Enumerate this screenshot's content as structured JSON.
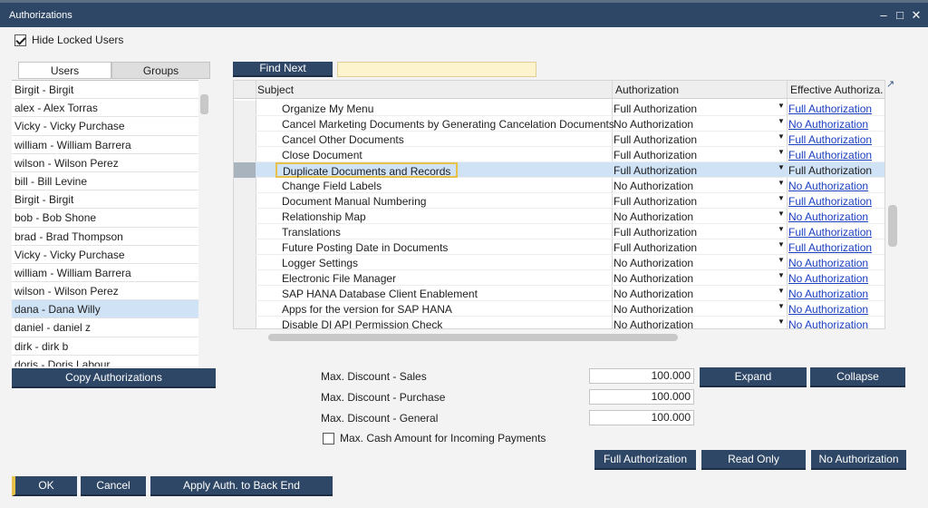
{
  "window": {
    "title": "Authorizations"
  },
  "hide_locked": {
    "label": "Hide Locked Users",
    "checked": true
  },
  "tabs": [
    {
      "label": "Users"
    },
    {
      "label": "Groups"
    }
  ],
  "users": [
    "Birgit - Birgit",
    "alex - Alex Torras",
    "Vicky - Vicky Purchase",
    "william - William Barrera",
    "wilson - Wilson Perez",
    "bill - Bill Levine",
    "Birgit - Birgit",
    "bob - Bob Shone",
    "brad - Brad Thompson",
    "Vicky - Vicky Purchase",
    "william - William Barrera",
    "wilson - Wilson Perez",
    "dana - Dana Willy",
    "daniel - daniel z",
    "dirk - dirk b",
    "doris - Doris Labour"
  ],
  "selected_user": "dana - Dana Willy",
  "find_next": {
    "label": "Find Next",
    "value": ""
  },
  "grid": {
    "headers": {
      "subject": "Subject",
      "authorization": "Authorization",
      "effective": "Effective Authoriza..."
    },
    "rows": [
      {
        "subject": "Organize My Menu",
        "authorization": "Full Authorization",
        "effective": "Full Authorization"
      },
      {
        "subject": "Cancel Marketing Documents by Generating Cancelation Documents",
        "authorization": "No Authorization",
        "effective": "No Authorization"
      },
      {
        "subject": "Cancel Other Documents",
        "authorization": "Full Authorization",
        "effective": "Full Authorization"
      },
      {
        "subject": "Close Document",
        "authorization": "Full Authorization",
        "effective": "Full Authorization"
      },
      {
        "subject": "Duplicate Documents and Records",
        "authorization": "Full Authorization",
        "effective": "Full Authorization"
      },
      {
        "subject": "Change Field Labels",
        "authorization": "No Authorization",
        "effective": "No Authorization"
      },
      {
        "subject": "Document Manual Numbering",
        "authorization": "Full Authorization",
        "effective": "Full Authorization"
      },
      {
        "subject": "Relationship Map",
        "authorization": "No Authorization",
        "effective": "No Authorization"
      },
      {
        "subject": "Translations",
        "authorization": "Full Authorization",
        "effective": "Full Authorization"
      },
      {
        "subject": "Future Posting Date in Documents",
        "authorization": "Full Authorization",
        "effective": "Full Authorization"
      },
      {
        "subject": "Logger Settings",
        "authorization": "No Authorization",
        "effective": "No Authorization"
      },
      {
        "subject": "Electronic File Manager",
        "authorization": "No Authorization",
        "effective": "No Authorization"
      },
      {
        "subject": "SAP HANA Database Client Enablement",
        "authorization": "No Authorization",
        "effective": "No Authorization"
      },
      {
        "subject": "Apps for the version for SAP HANA",
        "authorization": "No Authorization",
        "effective": "No Authorization"
      },
      {
        "subject": "Disable DI API Permission Check",
        "authorization": "No Authorization",
        "effective": "No Authorization"
      }
    ],
    "selected_row": "Duplicate Documents and Records"
  },
  "copy_authorizations": "Copy Authorizations",
  "discounts": {
    "sales_label": "Max. Discount - Sales",
    "sales_value": "100.000",
    "purchase_label": "Max. Discount - Purchase",
    "purchase_value": "100.000",
    "general_label": "Max. Discount - General",
    "general_value": "100.000"
  },
  "max_cash": {
    "label": "Max. Cash Amount for Incoming Payments",
    "checked": false
  },
  "buttons": {
    "expand": "Expand",
    "collapse": "Collapse",
    "full_authorization": "Full Authorization",
    "read_only": "Read Only",
    "no_authorization": "No Authorization",
    "ok": "OK",
    "cancel": "Cancel",
    "apply_auth": "Apply Auth. to Back End"
  },
  "colors": {
    "header": "#2f4766",
    "selection": "#cfe2f6",
    "highlight_border": "#e7c24b",
    "link": "#1a3fc0"
  }
}
